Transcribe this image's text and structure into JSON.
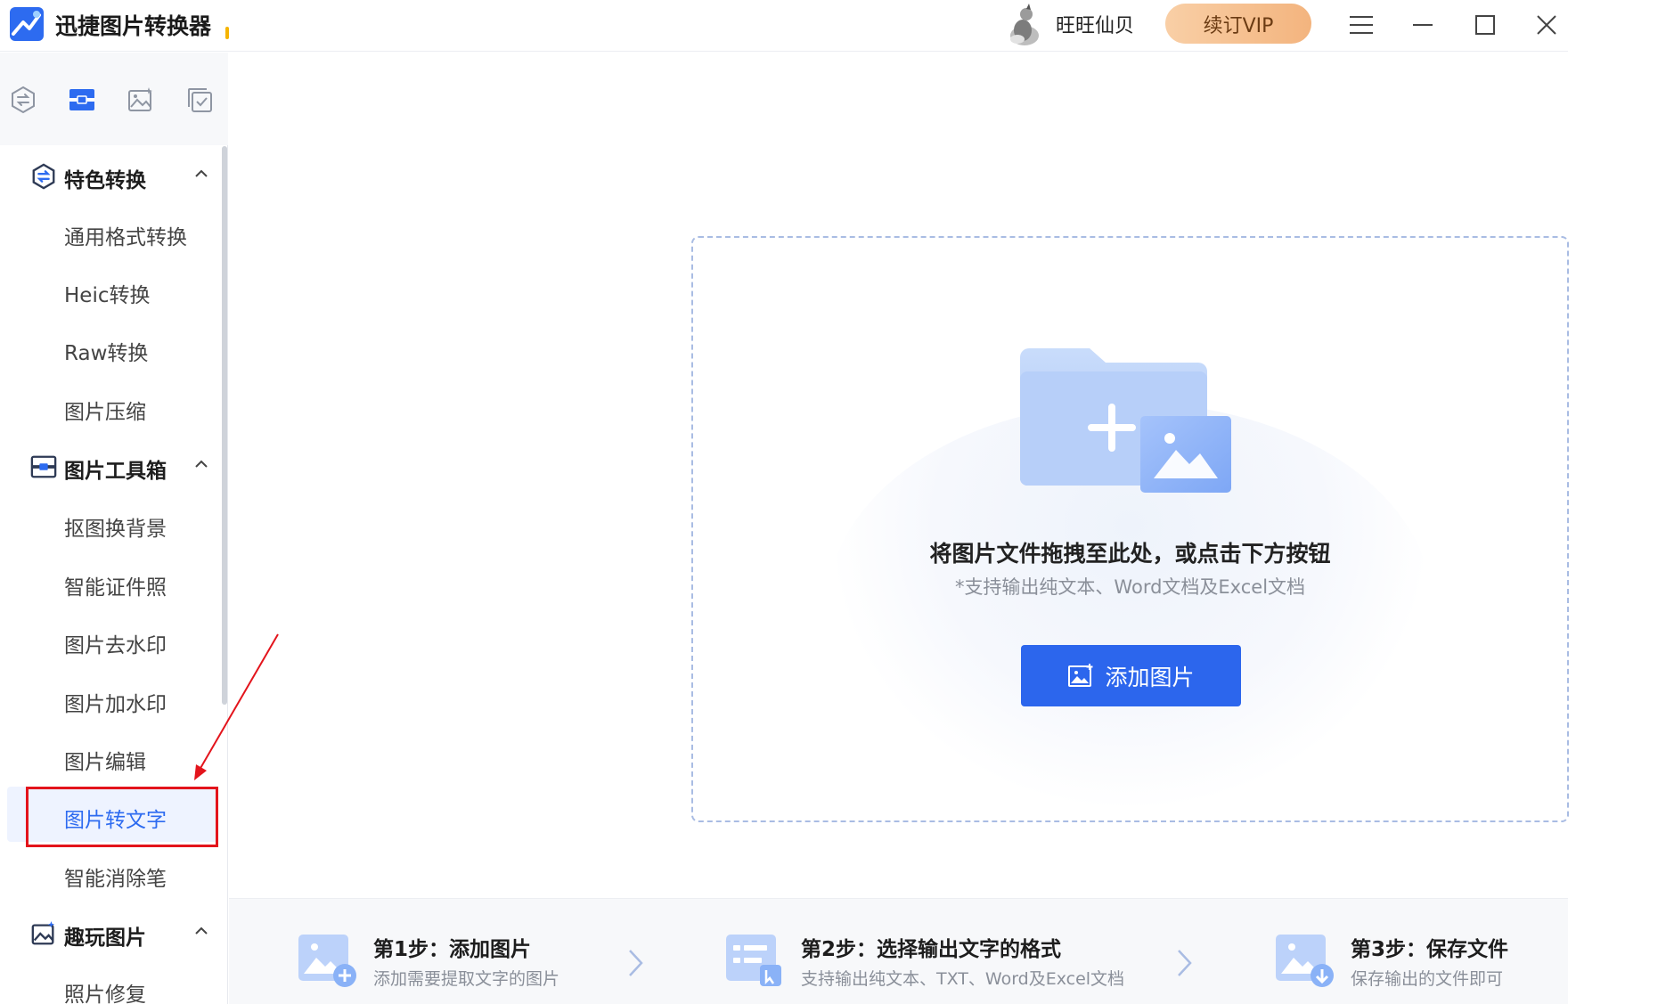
{
  "titlebar": {
    "app_title": "迅捷图片转换器",
    "user_name": "旺旺仙贝",
    "vip_button": "续订VIP",
    "icons": [
      "app-logo",
      "avatar",
      "menu-icon",
      "minimize-icon",
      "maximize-icon",
      "close-icon"
    ]
  },
  "sidebar": {
    "icon_tabs": [
      "convert-icon",
      "toolbox-icon",
      "image-fun-icon",
      "batch-check-icon"
    ],
    "sections": [
      {
        "label": "特色转换",
        "items": [
          "通用格式转换",
          "Heic转换",
          "Raw转换",
          "图片压缩"
        ]
      },
      {
        "label": "图片工具箱",
        "items": [
          "抠图换背景",
          "智能证件照",
          "图片去水印",
          "图片加水印",
          "图片编辑",
          "图片转文字",
          "智能消除笔"
        ]
      },
      {
        "label": "趣玩图片",
        "items": [
          "照片修复"
        ]
      }
    ],
    "selected_item": "图片转文字"
  },
  "main": {
    "drop_title": "将图片文件拖拽至此处，或点击下方按钮",
    "drop_subtitle": "*支持输出纯文本、Word文档及Excel文档",
    "add_button": "添加图片"
  },
  "steps": [
    {
      "title": "第1步：添加图片",
      "desc": "添加需要提取文字的图片"
    },
    {
      "title": "第2步：选择输出文字的格式",
      "desc": "支持输出纯文本、TXT、Word及Excel文档"
    },
    {
      "title": "第3步：保存文件",
      "desc": "保存输出的文件即可"
    }
  ],
  "colors": {
    "accent": "#2c66ed",
    "annotation": "#e3141c",
    "vip_gradient_start": "#f9cfa6",
    "vip_gradient_end": "#f3b47e"
  }
}
